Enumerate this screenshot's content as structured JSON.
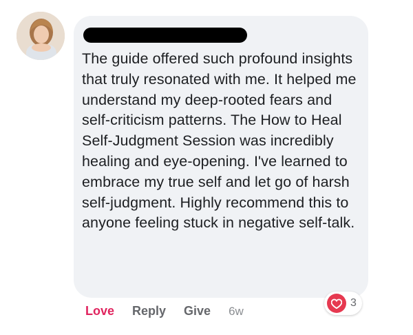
{
  "comment": {
    "author_name": "",
    "text": "The guide offered such profound insights that truly resonated with me. It helped me understand my deep-rooted fears and self-criticism patterns. The How to Heal Self-Judgment Session was incredibly healing and eye-opening. I've learned to embrace my true self and let go of harsh self-judgment. Highly recommend this to anyone feeling stuck in negative self-talk."
  },
  "actions": {
    "love_label": "Love",
    "reply_label": "Reply",
    "give_label": "Give",
    "timestamp": "6w"
  },
  "reactions": {
    "icon": "heart-icon",
    "count": "3",
    "color": "#e63950"
  },
  "colors": {
    "bubble_bg": "#f0f2f5",
    "love_active": "#e0245e",
    "action_text": "#65676b"
  }
}
